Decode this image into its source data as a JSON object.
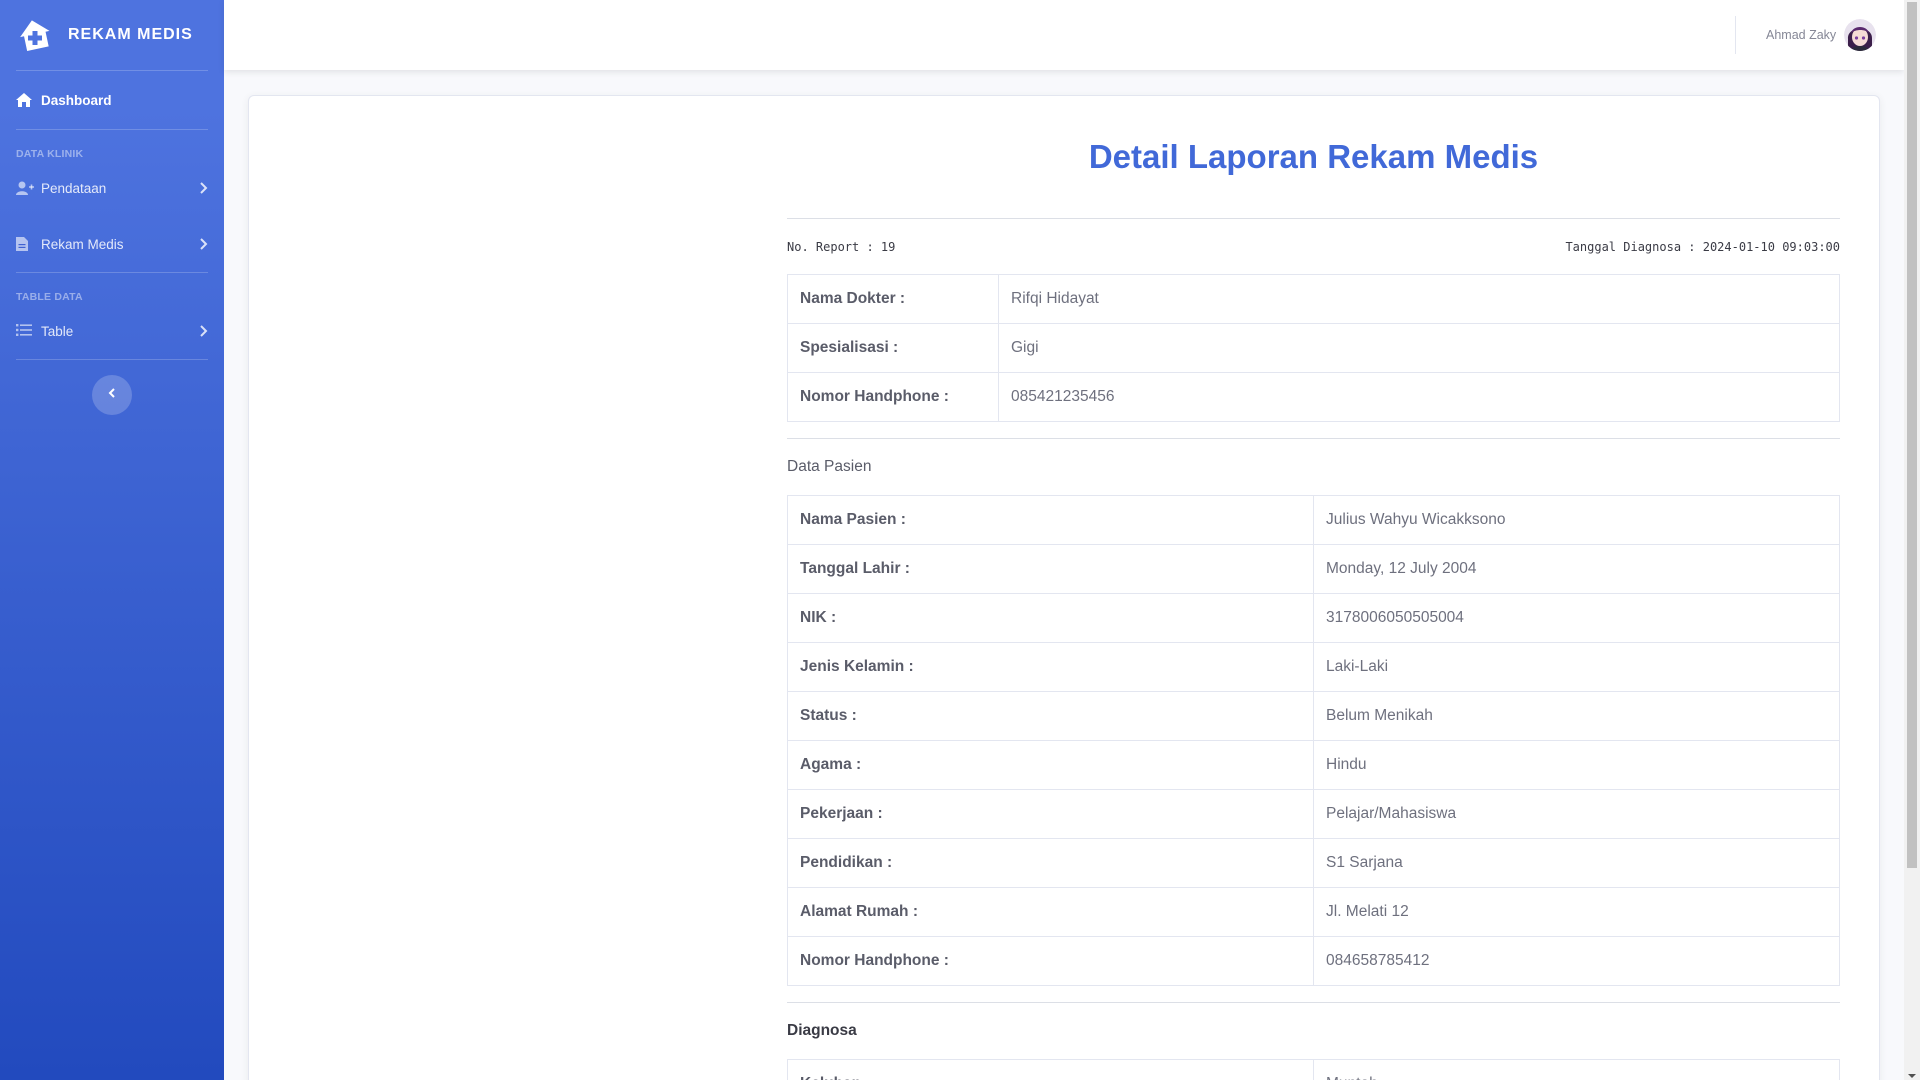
{
  "brand": {
    "name": "REKAM MEDIS"
  },
  "sidebar": {
    "dashboard": "Dashboard",
    "heading_clinic": "DATA KLINIK",
    "pendataan": "Pendataan",
    "rekam_medis": "Rekam Medis",
    "heading_table": "TABLE DATA",
    "table": "Table"
  },
  "topbar": {
    "user_name": "Ahmad Zaky"
  },
  "report": {
    "title": "Detail Laporan Rekam Medis",
    "report_no": "No. Report : 19",
    "diagnosis_date": "Tanggal Diagnosa : 2024-01-10 09:03:00"
  },
  "doctor": [
    {
      "label": "Nama Dokter :",
      "value": "Rifqi Hidayat"
    },
    {
      "label": "Spesialisasi :",
      "value": "Gigi"
    },
    {
      "label": "Nomor Handphone :",
      "value": "085421235456"
    }
  ],
  "patient_section": "Data Pasien",
  "patient": [
    {
      "label": "Nama Pasien :",
      "value": "Julius Wahyu Wicakksono"
    },
    {
      "label": "Tanggal Lahir :",
      "value": "Monday, 12 July 2004"
    },
    {
      "label": "NIK :",
      "value": "3178006050505004"
    },
    {
      "label": "Jenis Kelamin :",
      "value": "Laki-Laki"
    },
    {
      "label": "Status :",
      "value": "Belum Menikah"
    },
    {
      "label": "Agama :",
      "value": "Hindu"
    },
    {
      "label": "Pekerjaan :",
      "value": "Pelajar/Mahasiswa"
    },
    {
      "label": "Pendidikan :",
      "value": "S1 Sarjana"
    },
    {
      "label": "Alamat Rumah :",
      "value": "Jl. Melati 12"
    },
    {
      "label": "Nomor Handphone :",
      "value": "084658785412"
    }
  ],
  "diagnosis_section": "Diagnosa",
  "diagnosis": [
    {
      "label": "Keluhan :",
      "value": "Muntah"
    }
  ]
}
